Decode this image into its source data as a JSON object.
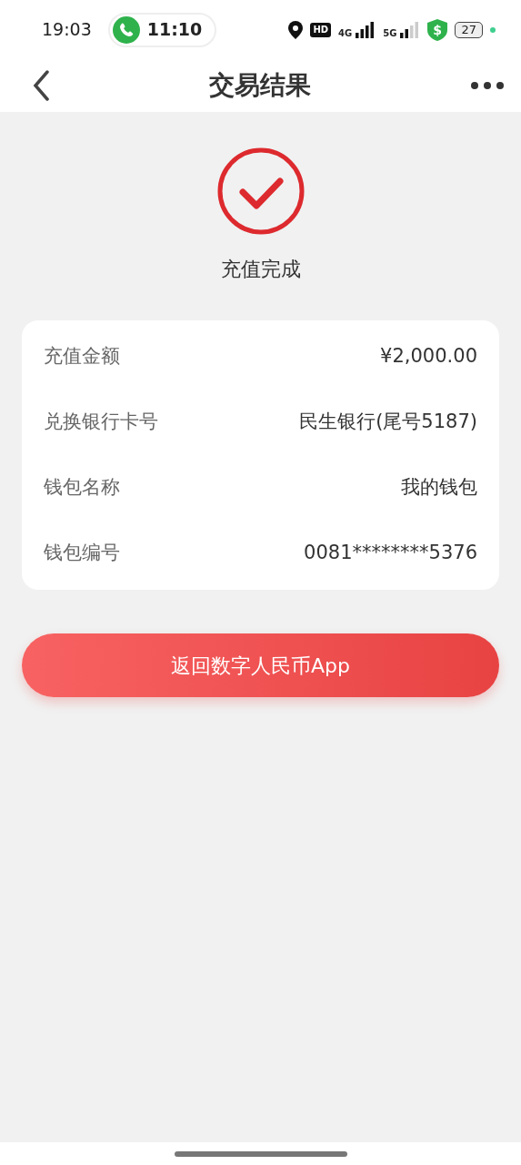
{
  "status_bar": {
    "time": "19:03",
    "call_time": "11:10",
    "hd_label": "HD",
    "network_labels": [
      "4G",
      "5G"
    ],
    "battery": "27",
    "shield_symbol": "$"
  },
  "header": {
    "title": "交易结果"
  },
  "result": {
    "message": "充值完成"
  },
  "details": [
    {
      "label": "充值金额",
      "value": "¥2,000.00"
    },
    {
      "label": "兑换银行卡号",
      "value": "民生银行(尾号5187)"
    },
    {
      "label": "钱包名称",
      "value": "我的钱包"
    },
    {
      "label": "钱包编号",
      "value": "0081********5376"
    }
  ],
  "button": {
    "label": "返回数字人民币App"
  }
}
